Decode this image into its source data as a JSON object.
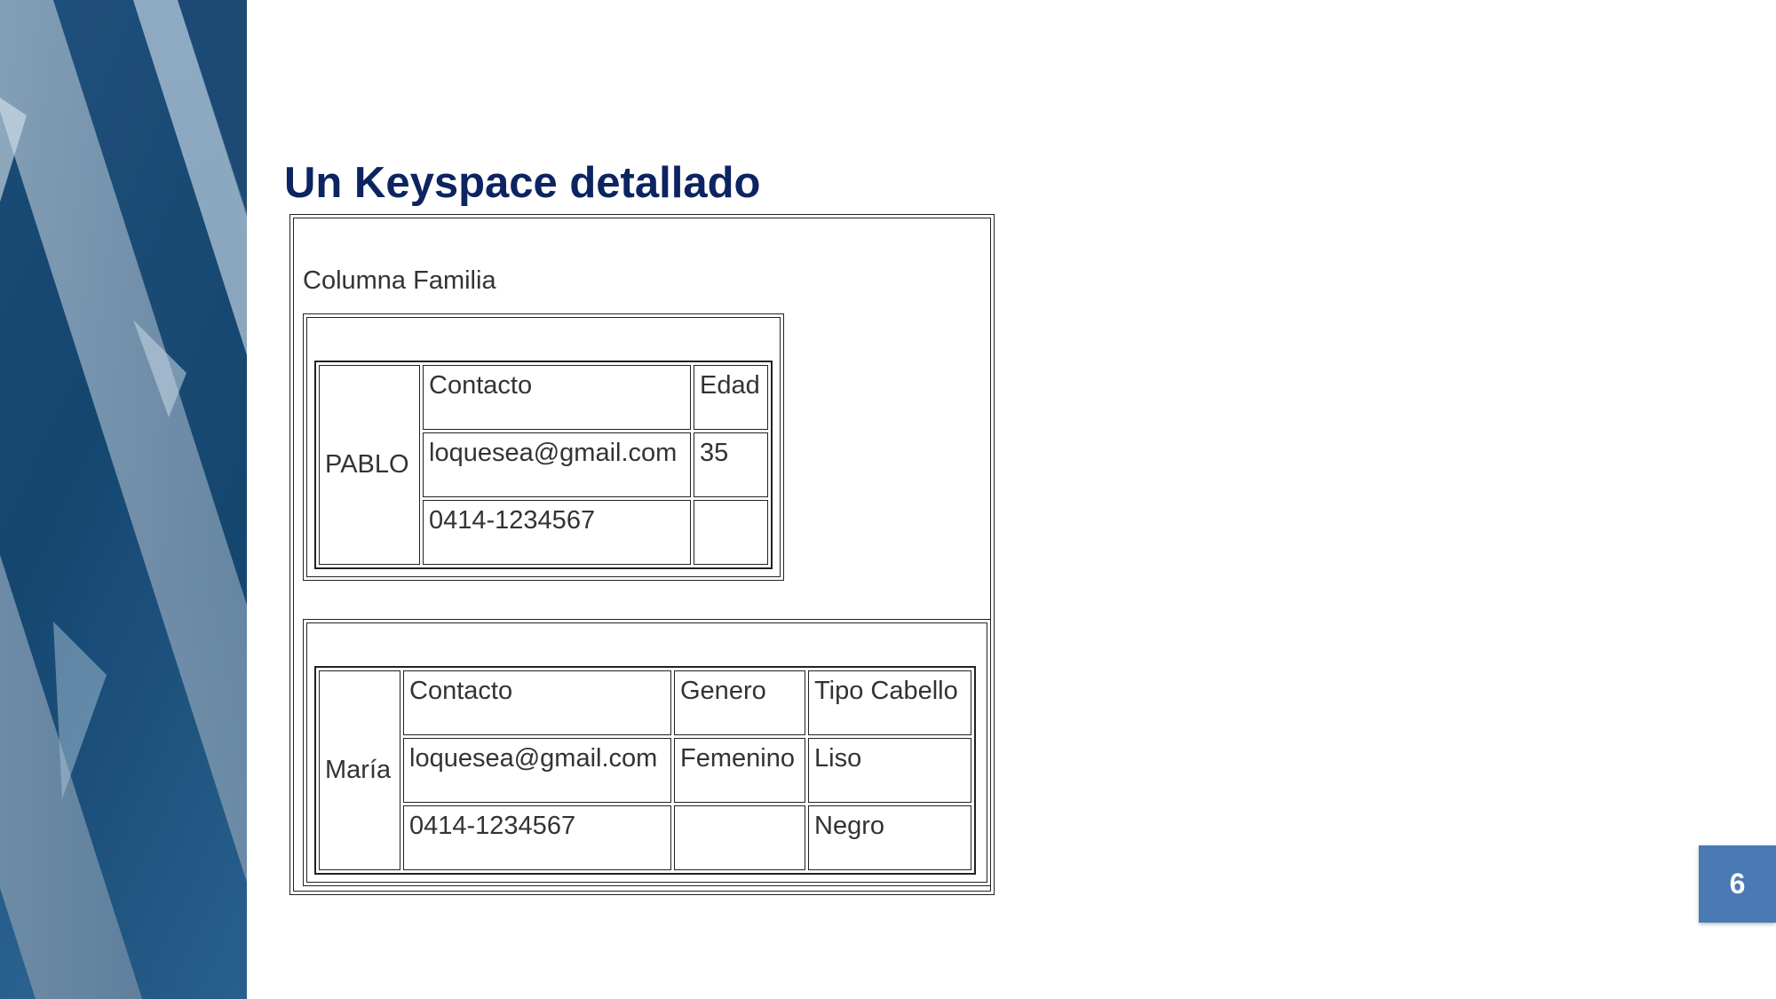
{
  "slide": {
    "title": "Un Keyspace detallado",
    "page_number": "6"
  },
  "figure": {
    "family_label": "Columna Familia",
    "rows": [
      {
        "key": "PABLO",
        "columns": [
          {
            "header": "Contacto",
            "values": [
              "loquesea@gmail.com",
              "0414-1234567"
            ]
          },
          {
            "header": "Edad",
            "values": [
              "35",
              ""
            ]
          }
        ]
      },
      {
        "key": "María",
        "columns": [
          {
            "header": "Contacto",
            "values": [
              "loquesea@gmail.com",
              "0414-1234567"
            ]
          },
          {
            "header": "Genero",
            "values": [
              "Femenino",
              ""
            ]
          },
          {
            "header": "Tipo Cabello",
            "values": [
              "Liso",
              "Negro"
            ]
          }
        ]
      }
    ]
  },
  "colors": {
    "title": "#0c2461",
    "badge": "#4a7ab4"
  }
}
